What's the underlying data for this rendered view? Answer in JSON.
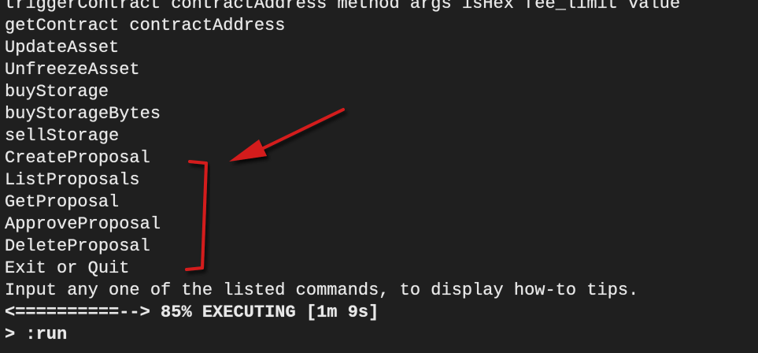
{
  "terminal": {
    "lines": [
      "triggerContract contractAddress method args isHex fee_limit value",
      "getContract contractAddress",
      "UpdateAsset",
      "UnfreezeAsset",
      "buyStorage",
      "buyStorageBytes",
      "sellStorage",
      "CreateProposal",
      "ListProposals",
      "GetProposal",
      "ApproveProposal",
      "DeleteProposal",
      "Exit or Quit",
      "Input any one of the listed commands, to display how-to tips."
    ],
    "progress": {
      "bar": "<==========-->",
      "percent": "85%",
      "status": "EXECUTING",
      "elapsed": "[1m 9s]",
      "value": 0.85
    },
    "prompt": {
      "symbol": ">",
      "command": ":run"
    }
  },
  "annotation": {
    "color": "#d41f1f",
    "highlighted_items": [
      "CreateProposal",
      "ListProposals",
      "GetProposal",
      "ApproveProposal",
      "DeleteProposal"
    ]
  }
}
